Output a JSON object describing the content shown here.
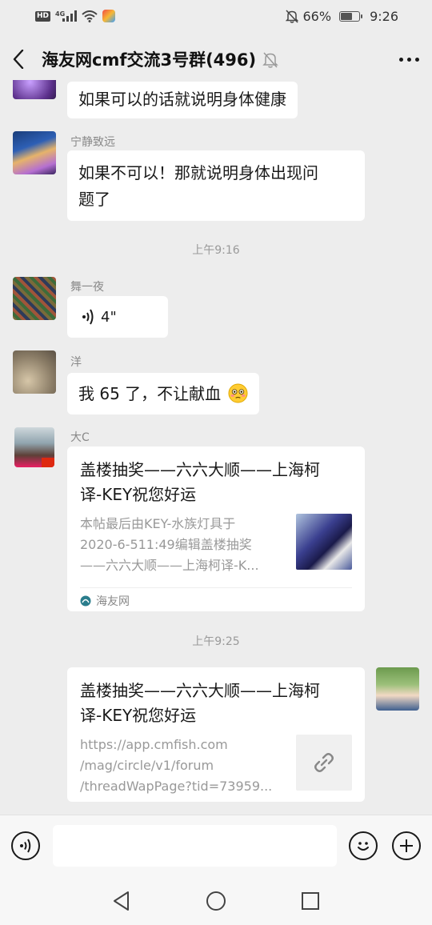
{
  "status_bar": {
    "network": "4G",
    "battery": "66%",
    "battery_level": 0.66,
    "time": "9:26"
  },
  "header": {
    "title": "海友网cmf交流3号群(496)"
  },
  "messages": {
    "m1": {
      "text": "如果可以的话就说明身体健康"
    },
    "m2": {
      "sender": "宁静致远",
      "line1": "如果不可以！那就说明身体出现问",
      "line2": "题了"
    },
    "time1": "上午9:16",
    "m3": {
      "sender": "舞一夜",
      "duration": "4\""
    },
    "m4": {
      "sender": "洋",
      "text": "我 65 了，不让献血"
    },
    "m5": {
      "sender": "大C",
      "title_line1": "盖楼抽奖——六六大顺——上海柯",
      "title_line2": "译-KEY祝您好运",
      "desc_line1": "本帖最后由KEY-水族灯具于",
      "desc_line2": "2020-6-511:49编辑盖楼抽奖",
      "desc_line3": "——六六大顺——上海柯译-K...",
      "source": "海友网"
    },
    "time2": "上午9:25",
    "m6": {
      "title_line1": "盖楼抽奖——六六大顺——上海柯",
      "title_line2": "译-KEY祝您好运",
      "url_line1": "https://app.cmfish.com",
      "url_line2": "/mag/circle/v1/forum",
      "url_line3": "/threadWapPage?tid=73959..."
    }
  },
  "input": {
    "value": ""
  },
  "icons": {
    "back": "chevron-left-icon",
    "mute": "bell-off-icon",
    "more": "more-dots-icon",
    "voice": "voice-wave-icon",
    "emoji": "smiley-icon",
    "plus": "plus-icon",
    "link": "link-icon"
  },
  "colors": {
    "background": "#ededed",
    "bubble": "#ffffff",
    "secondary_text": "#888888"
  }
}
